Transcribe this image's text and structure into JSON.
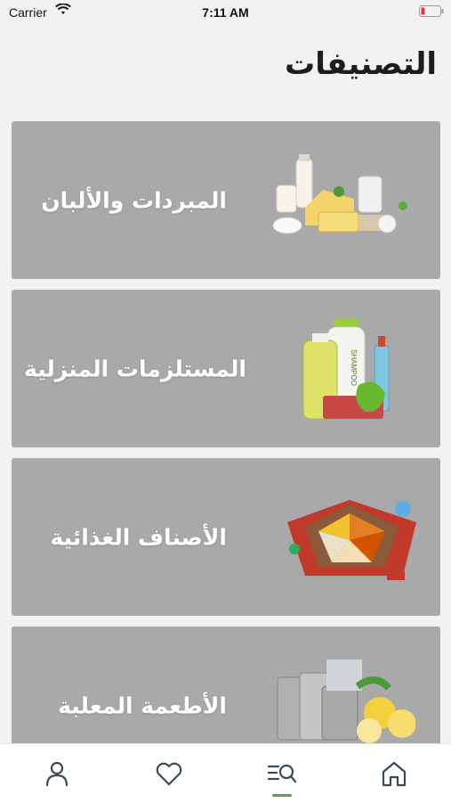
{
  "status_bar": {
    "carrier": "Carrier",
    "time": "7:11 AM"
  },
  "page": {
    "title": "التصنيفات"
  },
  "categories": [
    {
      "label": "المبردات والألبان",
      "icon": "dairy-products-image"
    },
    {
      "label": "المستلزمات المنزلية",
      "icon": "household-supplies-image"
    },
    {
      "label": "الأصناف الغذائية",
      "icon": "food-items-tray-image"
    },
    {
      "label": "الأطعمة المعلبة",
      "icon": "canned-food-image"
    }
  ],
  "tab_bar": {
    "tabs": [
      {
        "icon": "profile-icon"
      },
      {
        "icon": "heart-icon"
      },
      {
        "icon": "categories-search-icon",
        "active": true
      },
      {
        "icon": "home-icon"
      }
    ],
    "active_color": "#5aa34a"
  },
  "colors": {
    "card_background": "#a9a9a9",
    "page_background": "#f2f2f2"
  }
}
